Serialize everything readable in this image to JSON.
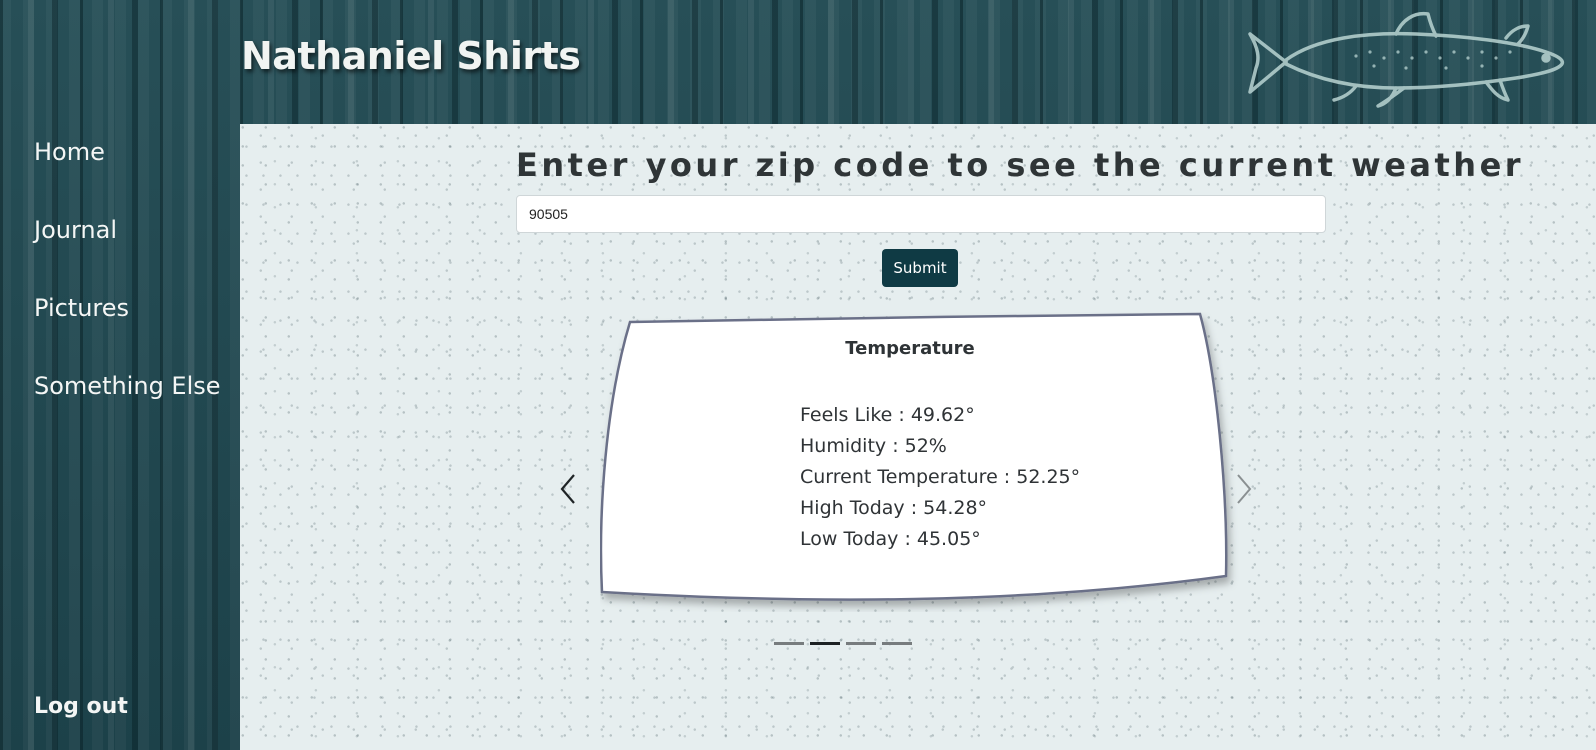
{
  "header": {
    "site_title": "Nathaniel Shirts",
    "logo_icon": "fish-icon"
  },
  "sidebar": {
    "items": [
      {
        "label": "Home"
      },
      {
        "label": "Journal"
      },
      {
        "label": "Pictures"
      },
      {
        "label": "Something Else"
      }
    ],
    "logout_label": "Log out"
  },
  "weather_form": {
    "prompt": "Enter your zip code to see the current weather",
    "zip_value": "90505",
    "submit_label": "Submit"
  },
  "carousel": {
    "card_title": "Temperature",
    "stats": [
      "Feels Like : 49.62°",
      "Humidity : 52%",
      "Current Temperature : 52.25°",
      "High Today : 54.28°",
      "Low Today : 45.05°"
    ],
    "prev_icon": "chevron-left-icon",
    "next_icon": "chevron-right-icon",
    "slide_count": 4,
    "active_slide": 2
  },
  "colors": {
    "accent": "#0f3a44",
    "sidebar_bg": "#1f4a52",
    "content_bg": "#e6eeef",
    "card_border": "#6b6f88"
  }
}
